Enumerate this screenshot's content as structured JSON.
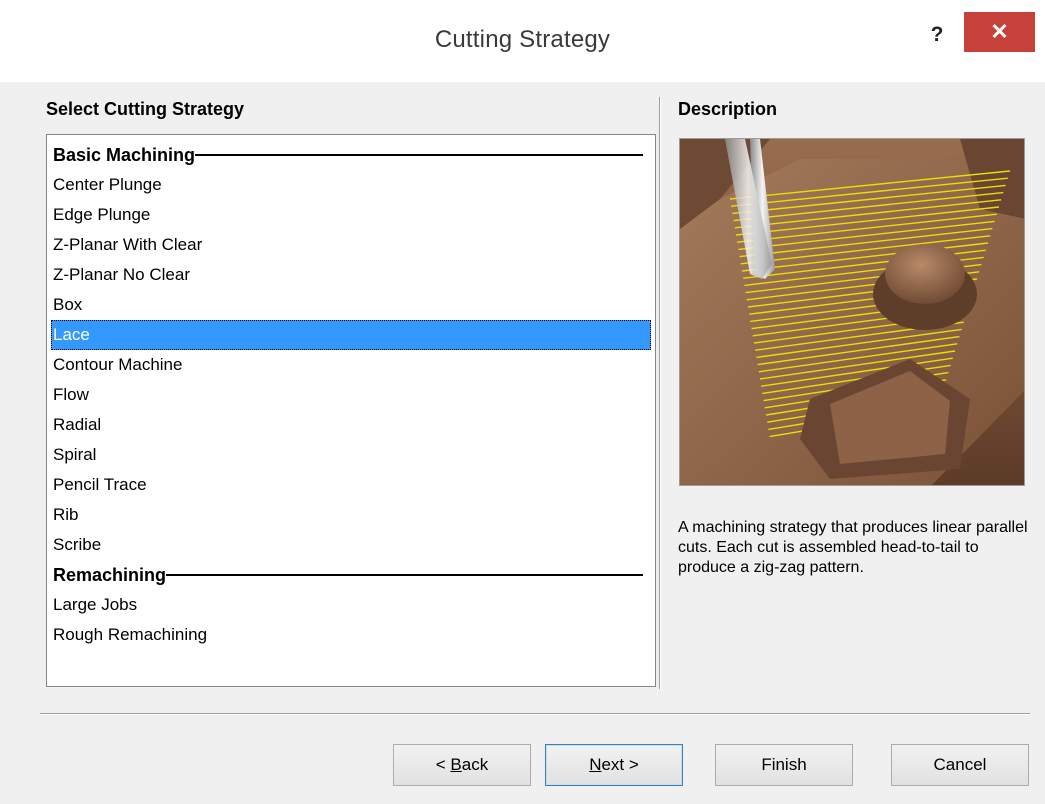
{
  "window": {
    "title": "Cutting Strategy",
    "help_label": "?",
    "close_label": "✕"
  },
  "left_panel": {
    "heading": "Select Cutting Strategy",
    "items": [
      {
        "label": "Basic Machining",
        "type": "group"
      },
      {
        "label": "Center Plunge",
        "type": "item"
      },
      {
        "label": "Edge Plunge",
        "type": "item"
      },
      {
        "label": "Z-Planar With Clear",
        "type": "item"
      },
      {
        "label": "Z-Planar No Clear",
        "type": "item"
      },
      {
        "label": "Box",
        "type": "item"
      },
      {
        "label": "Lace",
        "type": "item",
        "selected": true
      },
      {
        "label": "Contour Machine",
        "type": "item"
      },
      {
        "label": "Flow",
        "type": "item"
      },
      {
        "label": "Radial",
        "type": "item"
      },
      {
        "label": "Spiral",
        "type": "item"
      },
      {
        "label": "Pencil Trace",
        "type": "item"
      },
      {
        "label": "Rib",
        "type": "item"
      },
      {
        "label": "Scribe",
        "type": "item"
      },
      {
        "label": "Remachining",
        "type": "group"
      },
      {
        "label": "Large Jobs",
        "type": "item"
      },
      {
        "label": "Rough Remachining",
        "type": "item"
      }
    ]
  },
  "right_panel": {
    "heading": "Description",
    "description": "A machining strategy that produces linear parallel cuts.  Each cut is assembled head-to-tail to produce a zig-zag pattern."
  },
  "buttons": {
    "back_pre": "< ",
    "back_key": "B",
    "back_post": "ack",
    "next_key": "N",
    "next_post": "ext >",
    "finish": "Finish",
    "cancel": "Cancel"
  },
  "colors": {
    "accent": "#3399ff",
    "close": "#c7413b",
    "toolpath": "#e8e000",
    "part": "#7a5238"
  }
}
